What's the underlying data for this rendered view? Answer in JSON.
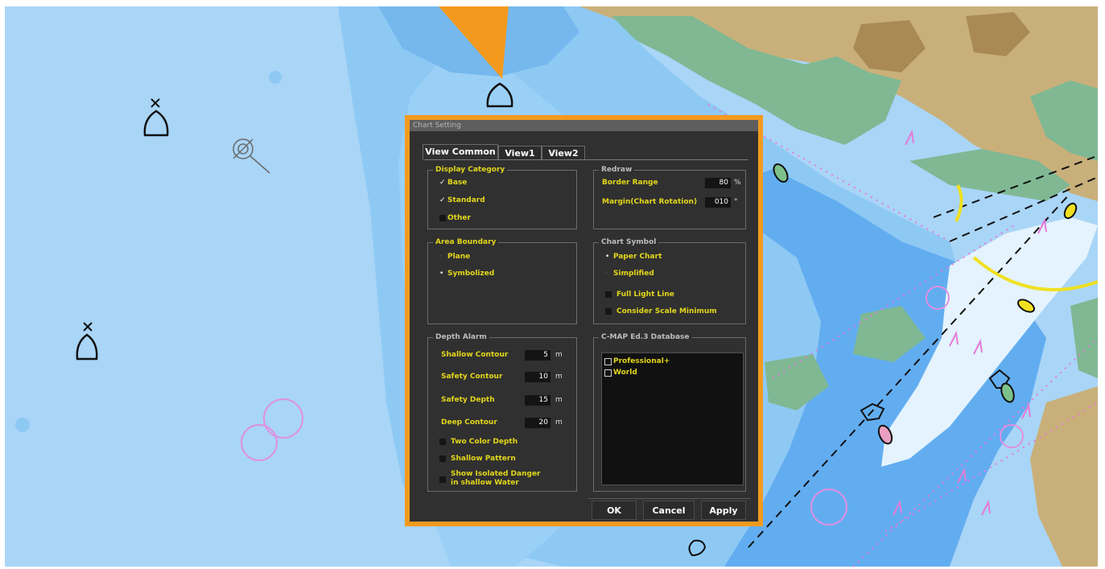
{
  "dialog": {
    "title": "Chart Setting",
    "tabs": [
      "View Common",
      "View1",
      "View2"
    ],
    "display_category": {
      "title": "Display Category",
      "items": [
        {
          "label": "Base",
          "checked": true
        },
        {
          "label": "Standard",
          "checked": true
        },
        {
          "label": "Other",
          "checked": false
        }
      ]
    },
    "redraw": {
      "title": "Redraw",
      "border_range": {
        "label": "Border Range",
        "value": "80",
        "unit": "%"
      },
      "margin": {
        "label": "Margin(Chart Rotation)",
        "value": "010",
        "unit": "°"
      }
    },
    "area_boundary": {
      "title": "Area Boundary",
      "options": [
        {
          "label": "Plane",
          "selected": false
        },
        {
          "label": "Symbolized",
          "selected": true
        }
      ]
    },
    "chart_symbol": {
      "title": "Chart Symbol",
      "options": [
        {
          "label": "Paper Chart",
          "selected": true
        },
        {
          "label": "Simplified",
          "selected": false
        }
      ],
      "checks": [
        {
          "label": "Full Light Line",
          "checked": false
        },
        {
          "label": "Consider Scale Minimum",
          "checked": false
        }
      ]
    },
    "depth_alarm": {
      "title": "Depth Alarm",
      "fields": [
        {
          "label": "Shallow Contour",
          "value": "5",
          "unit": "m"
        },
        {
          "label": "Safety Contour",
          "value": "10",
          "unit": "m"
        },
        {
          "label": "Safety Depth",
          "value": "15",
          "unit": "m"
        },
        {
          "label": "Deep Contour",
          "value": "20",
          "unit": "m"
        }
      ],
      "checks": [
        {
          "label": "Two Color Depth",
          "checked": false
        },
        {
          "label": "Shallow Pattern",
          "checked": false
        },
        {
          "label": "Show Isolated Danger",
          "label2": "in shallow Water",
          "checked": false
        }
      ]
    },
    "cmap": {
      "title": "C-MAP Ed.3 Database",
      "items": [
        {
          "label": "Professional+",
          "checked": false
        },
        {
          "label": "World",
          "checked": false
        }
      ]
    },
    "buttons": {
      "ok": "OK",
      "cancel": "Cancel",
      "apply": "Apply"
    }
  },
  "colors": {
    "deep_water": "#a9d5f7",
    "mid_water": "#8ac6f2",
    "shallow_water": "#5eaaf0",
    "land": "#c9b07a",
    "intertidal": "#7fb893",
    "highlight": "#f39a1e",
    "label_yellow": "#e3d71b",
    "route_magenta": "#e67ad8"
  }
}
